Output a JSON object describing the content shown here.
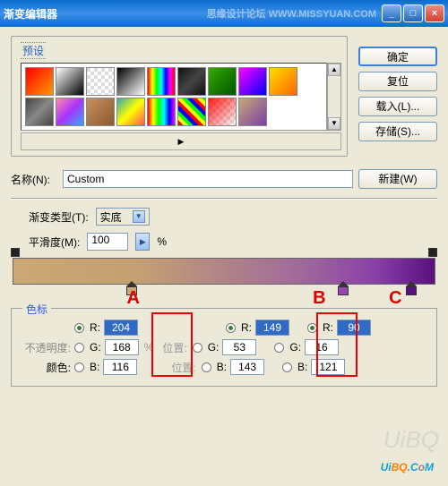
{
  "window": {
    "title": "渐变编辑器",
    "watermark_top": "思缘设计论坛  WWW.MISSYUAN.COM"
  },
  "buttons": {
    "ok": "确定",
    "reset": "复位",
    "load": "载入(L)...",
    "save": "存储(S)...",
    "new": "新建(W)"
  },
  "presets": {
    "label": "预设"
  },
  "name": {
    "label": "名称(N):",
    "value": "Custom"
  },
  "gradient": {
    "type_label": "渐变类型(T):",
    "type_value": "实底",
    "smooth_label": "平滑度(M):",
    "smooth_value": "100",
    "pct": "%"
  },
  "letters": {
    "a": "A",
    "b": "B",
    "c": "C"
  },
  "stops": {
    "title": "色标",
    "opacity_label": "不透明度:",
    "color_label": "颜色:",
    "pos_label": "位置:",
    "r": "R:",
    "g": "G:",
    "b": "B:",
    "a": {
      "r": "204",
      "g": "168",
      "b": "116"
    },
    "b_": {
      "r": "149",
      "g": "53",
      "b": "143"
    },
    "c_": {
      "r": "90",
      "g": "16",
      "b": "121"
    }
  },
  "watermark_bottom": {
    "u": "U",
    "i": "i",
    "b": "B",
    "q": "Q",
    "dot": ".",
    "c": "C",
    "o": "o",
    "m": "M"
  }
}
